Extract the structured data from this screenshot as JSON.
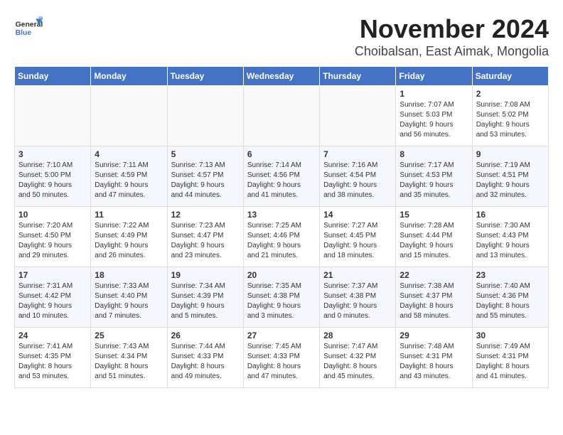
{
  "header": {
    "logo_line1": "General",
    "logo_line2": "Blue",
    "month": "November 2024",
    "location": "Choibalsan, East Aimak, Mongolia"
  },
  "days_of_week": [
    "Sunday",
    "Monday",
    "Tuesday",
    "Wednesday",
    "Thursday",
    "Friday",
    "Saturday"
  ],
  "weeks": [
    {
      "days": [
        {
          "num": "",
          "info": ""
        },
        {
          "num": "",
          "info": ""
        },
        {
          "num": "",
          "info": ""
        },
        {
          "num": "",
          "info": ""
        },
        {
          "num": "",
          "info": ""
        },
        {
          "num": "1",
          "info": "Sunrise: 7:07 AM\nSunset: 5:03 PM\nDaylight: 9 hours\nand 56 minutes."
        },
        {
          "num": "2",
          "info": "Sunrise: 7:08 AM\nSunset: 5:02 PM\nDaylight: 9 hours\nand 53 minutes."
        }
      ]
    },
    {
      "days": [
        {
          "num": "3",
          "info": "Sunrise: 7:10 AM\nSunset: 5:00 PM\nDaylight: 9 hours\nand 50 minutes."
        },
        {
          "num": "4",
          "info": "Sunrise: 7:11 AM\nSunset: 4:59 PM\nDaylight: 9 hours\nand 47 minutes."
        },
        {
          "num": "5",
          "info": "Sunrise: 7:13 AM\nSunset: 4:57 PM\nDaylight: 9 hours\nand 44 minutes."
        },
        {
          "num": "6",
          "info": "Sunrise: 7:14 AM\nSunset: 4:56 PM\nDaylight: 9 hours\nand 41 minutes."
        },
        {
          "num": "7",
          "info": "Sunrise: 7:16 AM\nSunset: 4:54 PM\nDaylight: 9 hours\nand 38 minutes."
        },
        {
          "num": "8",
          "info": "Sunrise: 7:17 AM\nSunset: 4:53 PM\nDaylight: 9 hours\nand 35 minutes."
        },
        {
          "num": "9",
          "info": "Sunrise: 7:19 AM\nSunset: 4:51 PM\nDaylight: 9 hours\nand 32 minutes."
        }
      ]
    },
    {
      "days": [
        {
          "num": "10",
          "info": "Sunrise: 7:20 AM\nSunset: 4:50 PM\nDaylight: 9 hours\nand 29 minutes."
        },
        {
          "num": "11",
          "info": "Sunrise: 7:22 AM\nSunset: 4:49 PM\nDaylight: 9 hours\nand 26 minutes."
        },
        {
          "num": "12",
          "info": "Sunrise: 7:23 AM\nSunset: 4:47 PM\nDaylight: 9 hours\nand 23 minutes."
        },
        {
          "num": "13",
          "info": "Sunrise: 7:25 AM\nSunset: 4:46 PM\nDaylight: 9 hours\nand 21 minutes."
        },
        {
          "num": "14",
          "info": "Sunrise: 7:27 AM\nSunset: 4:45 PM\nDaylight: 9 hours\nand 18 minutes."
        },
        {
          "num": "15",
          "info": "Sunrise: 7:28 AM\nSunset: 4:44 PM\nDaylight: 9 hours\nand 15 minutes."
        },
        {
          "num": "16",
          "info": "Sunrise: 7:30 AM\nSunset: 4:43 PM\nDaylight: 9 hours\nand 13 minutes."
        }
      ]
    },
    {
      "days": [
        {
          "num": "17",
          "info": "Sunrise: 7:31 AM\nSunset: 4:42 PM\nDaylight: 9 hours\nand 10 minutes."
        },
        {
          "num": "18",
          "info": "Sunrise: 7:33 AM\nSunset: 4:40 PM\nDaylight: 9 hours\nand 7 minutes."
        },
        {
          "num": "19",
          "info": "Sunrise: 7:34 AM\nSunset: 4:39 PM\nDaylight: 9 hours\nand 5 minutes."
        },
        {
          "num": "20",
          "info": "Sunrise: 7:35 AM\nSunset: 4:38 PM\nDaylight: 9 hours\nand 3 minutes."
        },
        {
          "num": "21",
          "info": "Sunrise: 7:37 AM\nSunset: 4:38 PM\nDaylight: 9 hours\nand 0 minutes."
        },
        {
          "num": "22",
          "info": "Sunrise: 7:38 AM\nSunset: 4:37 PM\nDaylight: 8 hours\nand 58 minutes."
        },
        {
          "num": "23",
          "info": "Sunrise: 7:40 AM\nSunset: 4:36 PM\nDaylight: 8 hours\nand 55 minutes."
        }
      ]
    },
    {
      "days": [
        {
          "num": "24",
          "info": "Sunrise: 7:41 AM\nSunset: 4:35 PM\nDaylight: 8 hours\nand 53 minutes."
        },
        {
          "num": "25",
          "info": "Sunrise: 7:43 AM\nSunset: 4:34 PM\nDaylight: 8 hours\nand 51 minutes."
        },
        {
          "num": "26",
          "info": "Sunrise: 7:44 AM\nSunset: 4:33 PM\nDaylight: 8 hours\nand 49 minutes."
        },
        {
          "num": "27",
          "info": "Sunrise: 7:45 AM\nSunset: 4:33 PM\nDaylight: 8 hours\nand 47 minutes."
        },
        {
          "num": "28",
          "info": "Sunrise: 7:47 AM\nSunset: 4:32 PM\nDaylight: 8 hours\nand 45 minutes."
        },
        {
          "num": "29",
          "info": "Sunrise: 7:48 AM\nSunset: 4:31 PM\nDaylight: 8 hours\nand 43 minutes."
        },
        {
          "num": "30",
          "info": "Sunrise: 7:49 AM\nSunset: 4:31 PM\nDaylight: 8 hours\nand 41 minutes."
        }
      ]
    }
  ]
}
